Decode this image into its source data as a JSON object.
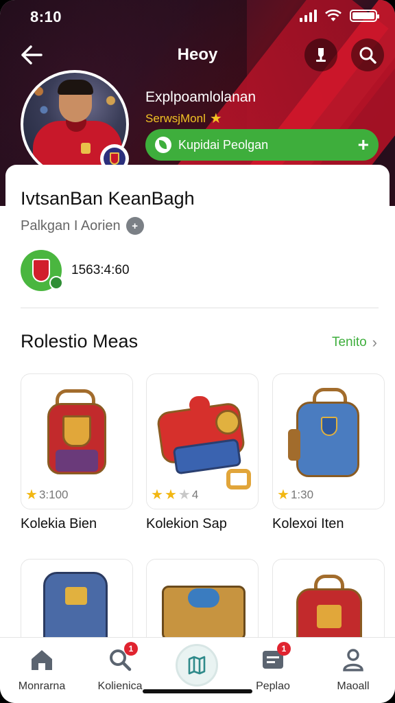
{
  "status": {
    "time": "8:10"
  },
  "nav": {
    "title": "Heoy"
  },
  "profile": {
    "title": "Explpoamlolanan",
    "subtitle": "SerwsjMonl",
    "action_label": "Kupidai Peolgan",
    "name": "IvtsanBan KeanBagh",
    "location": "Palkgan I Aorien",
    "club_value": "1563:4:60"
  },
  "section": {
    "title": "Rolestio Meas",
    "link": "Tenito"
  },
  "items": [
    {
      "name": "Kolekia Bien",
      "rating_text": "3:100",
      "stars": 1
    },
    {
      "name": "Kolekion Sap",
      "rating_text": "4",
      "stars": 2
    },
    {
      "name": "Kolexoi Iten",
      "rating_text": "1:30",
      "stars": 1
    }
  ],
  "tabs": [
    {
      "label": "Monrarna",
      "icon": "home-icon"
    },
    {
      "label": "Kolienica",
      "icon": "search-icon",
      "badge": "1"
    },
    {
      "label": "",
      "icon": "map-icon"
    },
    {
      "label": "Peplao",
      "icon": "inbox-icon",
      "badge": "1"
    },
    {
      "label": "Maoall",
      "icon": "profile-icon"
    }
  ],
  "colors": {
    "accent_green": "#3eae3c",
    "star": "#f2b713",
    "header_red": "#c4162c"
  }
}
